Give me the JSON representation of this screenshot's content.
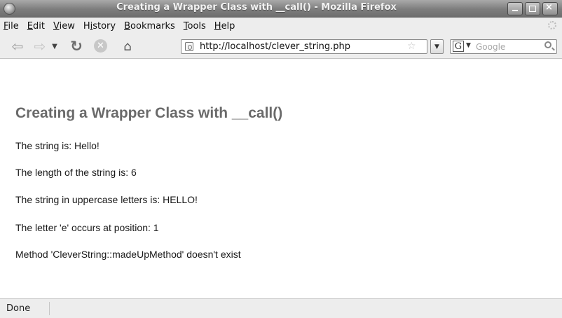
{
  "window": {
    "title": "Creating a Wrapper Class with __call() - Mozilla Firefox",
    "controls": {
      "minimize": "_",
      "maximize": "□",
      "close": "×"
    }
  },
  "menu": {
    "items": [
      {
        "label": "File",
        "underline": "F",
        "rest": "ile"
      },
      {
        "label": "Edit",
        "underline": "E",
        "rest": "dit"
      },
      {
        "label": "View",
        "underline": "V",
        "rest": "iew"
      },
      {
        "label": "History",
        "underline": "",
        "rest": "History",
        "ul_index": 1
      },
      {
        "label": "Bookmarks",
        "underline": "B",
        "rest": "ookmarks"
      },
      {
        "label": "Tools",
        "underline": "T",
        "rest": "ools"
      },
      {
        "label": "Help",
        "underline": "H",
        "rest": "elp"
      }
    ]
  },
  "toolbar": {
    "back_glyph": "⇦",
    "forward_glyph": "⇨",
    "history_dropdown_glyph": "▼",
    "reload_glyph": "↻",
    "stop_glyph": "✕",
    "home_glyph": "⌂",
    "url": "http://localhost/clever_string.php",
    "bookmark_star_glyph": "☆",
    "url_dropdown_glyph": "▼",
    "search_engine_glyph": "G",
    "search_engine_dropdown_glyph": "▼",
    "search_placeholder": "Google"
  },
  "page": {
    "heading": "Creating a Wrapper Class with __call()",
    "lines": [
      "The string is: Hello!",
      "The length of the string is: 6",
      "The string in uppercase letters is: HELLO!",
      "The letter 'e' occurs at position: 1",
      "Method 'CleverString::madeUpMethod' doesn't exist"
    ]
  },
  "status": {
    "text": "Done"
  },
  "icons": [
    "browser-app-icon",
    "minimize-icon",
    "maximize-icon",
    "close-icon",
    "activity-throbber-icon",
    "back-arrow-icon",
    "forward-arrow-icon",
    "chevron-down-icon",
    "reload-icon",
    "stop-icon",
    "home-icon",
    "page-icon",
    "bookmark-star-icon",
    "google-engine-icon",
    "search-icon"
  ],
  "colors": {
    "titlebar": "#7d7d7d",
    "heading": "#6a6a6a",
    "chrome": "#ededed"
  }
}
